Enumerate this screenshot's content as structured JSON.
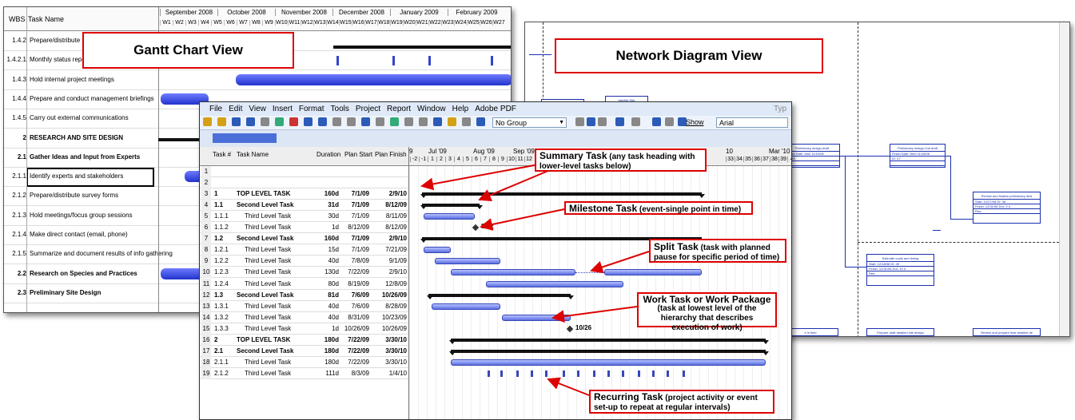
{
  "gantt": {
    "headers": {
      "wbs": "WBS",
      "name": "Task Name"
    },
    "months": [
      "September 2008",
      "October 2008",
      "November 2008",
      "December 2008",
      "January 2009",
      "February 2009"
    ],
    "weeks": [
      "W1",
      "W2",
      "W3",
      "W4",
      "W5",
      "W6",
      "W7",
      "W8",
      "W9",
      "W10",
      "W11",
      "W12",
      "W13",
      "W14",
      "W15",
      "W16",
      "W17",
      "W18",
      "W19",
      "W20",
      "W21",
      "W22",
      "W23",
      "W24",
      "W25",
      "W26",
      "W27"
    ],
    "rows": [
      {
        "wbs": "1.4.2",
        "name": "Prepare/distribute mo",
        "bold": false
      },
      {
        "wbs": "1.4.2.1",
        "name": "Monthly status report compilation",
        "bold": false
      },
      {
        "wbs": "1.4.3",
        "name": "Hold internal project meetings",
        "bold": false
      },
      {
        "wbs": "1.4.4",
        "name": "Prepare and conduct management briefings",
        "bold": false
      },
      {
        "wbs": "1.4.5",
        "name": "Carry out external communications",
        "bold": false
      },
      {
        "wbs": "2",
        "name": "RESEARCH AND SITE DESIGN",
        "bold": true
      },
      {
        "wbs": "2.1",
        "name": "Gather Ideas and Input from Experts",
        "bold": true
      },
      {
        "wbs": "2.1.1",
        "name": "Identify experts and stakeholders",
        "bold": false
      },
      {
        "wbs": "2.1.2",
        "name": "Prepare/distribute survey forms",
        "bold": false
      },
      {
        "wbs": "2.1.3",
        "name": "Hold meetings/focus group sessions",
        "bold": false
      },
      {
        "wbs": "2.1.4",
        "name": "Make direct contact (email, phone)",
        "bold": false
      },
      {
        "wbs": "2.1.5",
        "name": "Summarize and document results of info gathering",
        "bold": false
      },
      {
        "wbs": "2.2",
        "name": "Research on Species and Practices",
        "bold": true
      },
      {
        "wbs": "2.3",
        "name": "Preliminary Site Design",
        "bold": true
      }
    ],
    "label": "Gantt Chart View"
  },
  "network": {
    "label": "Network Diagram View",
    "nodes": [
      {
        "title": "Evaluate potential sites",
        "r1": "Start: 10/10/08     ID: 45",
        "r2": "",
        "r3": ""
      },
      {
        "title": "Identify Site",
        "r1": "",
        "r2": "",
        "r3": ""
      },
      {
        "title": "Preliminary design-draft",
        "r1": "Finish Date: Mon 11/10/08",
        "r2": "ID: 46",
        "r3": ""
      },
      {
        "title": "Preliminary design-2nd draft",
        "r1": "Finish Date: Wed 11/26/08",
        "r2": "ID: 47",
        "r3": ""
      },
      {
        "title": "Review and finalize preliminary desi",
        "r1": "Start: 12/27/08     ID: 48",
        "r2": "Finish: 12/31/08     Dur: 3 d",
        "r3": "Res:"
      },
      {
        "title": "Estimate costs and timing",
        "r1": "Start: 12/18/08     ID: 49",
        "r2": "Finish: 12/31/08     Dur: 10 d",
        "r3": "Res:"
      },
      {
        "title": "e in field",
        "r1": "",
        "r2": "",
        "r3": ""
      },
      {
        "title": "Prepare draft detailed site design",
        "r1": "Start: 12/18/08     ID: 50",
        "r2": "Finish: 1/20/09     Dur: 20 d",
        "r3": "Res:"
      },
      {
        "title": "Review and prepare final detailed de",
        "r1": "Start: 1/21/09     ID: 51",
        "r2": "Finish: 2/11/09     Dur: 15 d",
        "r3": "Res:"
      }
    ]
  },
  "project": {
    "menu": [
      "File",
      "Edit",
      "View",
      "Insert",
      "Format",
      "Tools",
      "Project",
      "Report",
      "Window",
      "Help",
      "Adobe PDF"
    ],
    "typ": "Typ",
    "group": "No Group",
    "show": "Show",
    "font": "Arial",
    "headers": {
      "task": "Task #",
      "name": "Task Name",
      "dur": "Duration",
      "start": "Plan Start",
      "finish": "Plan Finish"
    },
    "timescale_months": [
      "9",
      "Jul '09",
      "Aug '09",
      "Sep '09",
      "10",
      "Mar '10"
    ],
    "timescale_nums": [
      "-2",
      "-1",
      "1",
      "2",
      "3",
      "4",
      "5",
      "6",
      "7",
      "8",
      "9",
      "10",
      "11",
      "12"
    ],
    "timescale_nums_right": [
      "33",
      "34",
      "35",
      "36",
      "37",
      "38",
      "39",
      "4"
    ],
    "rows": [
      {
        "id": "1",
        "wbs": "",
        "name": "",
        "dur": "",
        "start": "",
        "finish": "",
        "bold": false
      },
      {
        "id": "2",
        "wbs": "",
        "name": "",
        "dur": "",
        "start": "",
        "finish": "",
        "bold": false
      },
      {
        "id": "3",
        "wbs": "1",
        "name": "TOP LEVEL TASK",
        "dur": "160d",
        "start": "7/1/09",
        "finish": "2/9/10",
        "bold": true
      },
      {
        "id": "4",
        "wbs": "1.1",
        "name": "Second Level Task",
        "dur": "31d",
        "start": "7/1/09",
        "finish": "8/12/09",
        "bold": true
      },
      {
        "id": "5",
        "wbs": "1.1.1",
        "name": "Third Level Task",
        "dur": "30d",
        "start": "7/1/09",
        "finish": "8/11/09",
        "bold": false
      },
      {
        "id": "6",
        "wbs": "1.1.2",
        "name": "Third Level Task",
        "dur": "1d",
        "start": "8/12/09",
        "finish": "8/12/09",
        "bold": false
      },
      {
        "id": "7",
        "wbs": "1.2",
        "name": "Second Level Task",
        "dur": "160d",
        "start": "7/1/09",
        "finish": "2/9/10",
        "bold": true
      },
      {
        "id": "8",
        "wbs": "1.2.1",
        "name": "Third Level Task",
        "dur": "15d",
        "start": "7/1/09",
        "finish": "7/21/09",
        "bold": false
      },
      {
        "id": "9",
        "wbs": "1.2.2",
        "name": "Third Level Task",
        "dur": "40d",
        "start": "7/8/09",
        "finish": "9/1/09",
        "bold": false
      },
      {
        "id": "10",
        "wbs": "1.2.3",
        "name": "Third Level Task",
        "dur": "130d",
        "start": "7/22/09",
        "finish": "2/9/10",
        "bold": false
      },
      {
        "id": "11",
        "wbs": "1.2.4",
        "name": "Third Level Task",
        "dur": "80d",
        "start": "8/19/09",
        "finish": "12/8/09",
        "bold": false
      },
      {
        "id": "12",
        "wbs": "1.3",
        "name": "Second Level Task",
        "dur": "81d",
        "start": "7/6/09",
        "finish": "10/26/09",
        "bold": true
      },
      {
        "id": "13",
        "wbs": "1.3.1",
        "name": "Third Level Task",
        "dur": "40d",
        "start": "7/6/09",
        "finish": "8/28/09",
        "bold": false
      },
      {
        "id": "14",
        "wbs": "1.3.2",
        "name": "Third Level Task",
        "dur": "40d",
        "start": "8/31/09",
        "finish": "10/23/09",
        "bold": false
      },
      {
        "id": "15",
        "wbs": "1.3.3",
        "name": "Third Level Task",
        "dur": "1d",
        "start": "10/26/09",
        "finish": "10/26/09",
        "bold": false
      },
      {
        "id": "16",
        "wbs": "2",
        "name": "TOP LEVEL TASK",
        "dur": "180d",
        "start": "7/22/09",
        "finish": "3/30/10",
        "bold": true
      },
      {
        "id": "17",
        "wbs": "2.1",
        "name": "Second Level Task",
        "dur": "180d",
        "start": "7/22/09",
        "finish": "3/30/10",
        "bold": true
      },
      {
        "id": "18",
        "wbs": "2.1.1",
        "name": "Third Level Task",
        "dur": "180d",
        "start": "7/22/09",
        "finish": "3/30/10",
        "bold": false
      },
      {
        "id": "19",
        "wbs": "2.1.2",
        "name": "Third Level Task",
        "dur": "111d",
        "start": "8/3/09",
        "finish": "1/4/10",
        "bold": false
      }
    ],
    "milestones": [
      "8/12",
      "10/26"
    ]
  },
  "callouts": [
    {
      "title": "Summary Task",
      "desc": " (any task heading with lower-level tasks below)"
    },
    {
      "title": "Milestone Task",
      "desc": " (event-single point in time)"
    },
    {
      "title": "Split Task",
      "desc": " (task with planned pause for specific period of time)"
    },
    {
      "title": "Work Task or Work Package",
      "desc": "(task at lowest level of the hierarchy that describes execution of work)"
    },
    {
      "title": "Recurring Task",
      "desc": " (project activity or event set-up to repeat at regular intervals)"
    }
  ]
}
